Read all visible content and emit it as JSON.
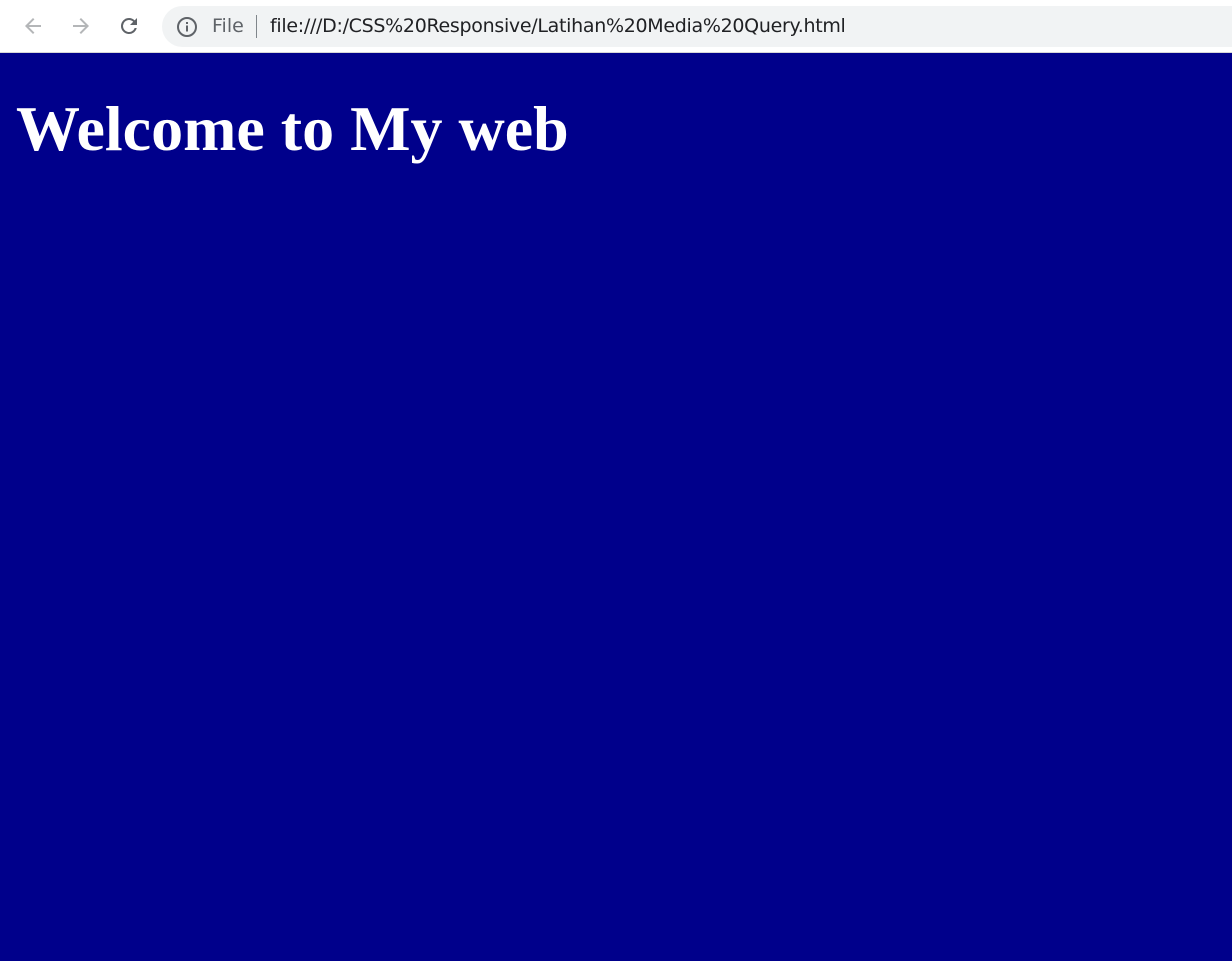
{
  "browser": {
    "nav": {
      "back_icon": "arrow-left-icon",
      "forward_icon": "arrow-right-icon",
      "reload_icon": "reload-icon"
    },
    "address_bar": {
      "info_icon": "info-icon",
      "scheme_label": "File",
      "url": "file:///D:/CSS%20Responsive/Latihan%20Media%20Query.html"
    }
  },
  "page": {
    "heading": "Welcome to My web",
    "background_color": "#00008b",
    "heading_color": "#ffffff"
  }
}
